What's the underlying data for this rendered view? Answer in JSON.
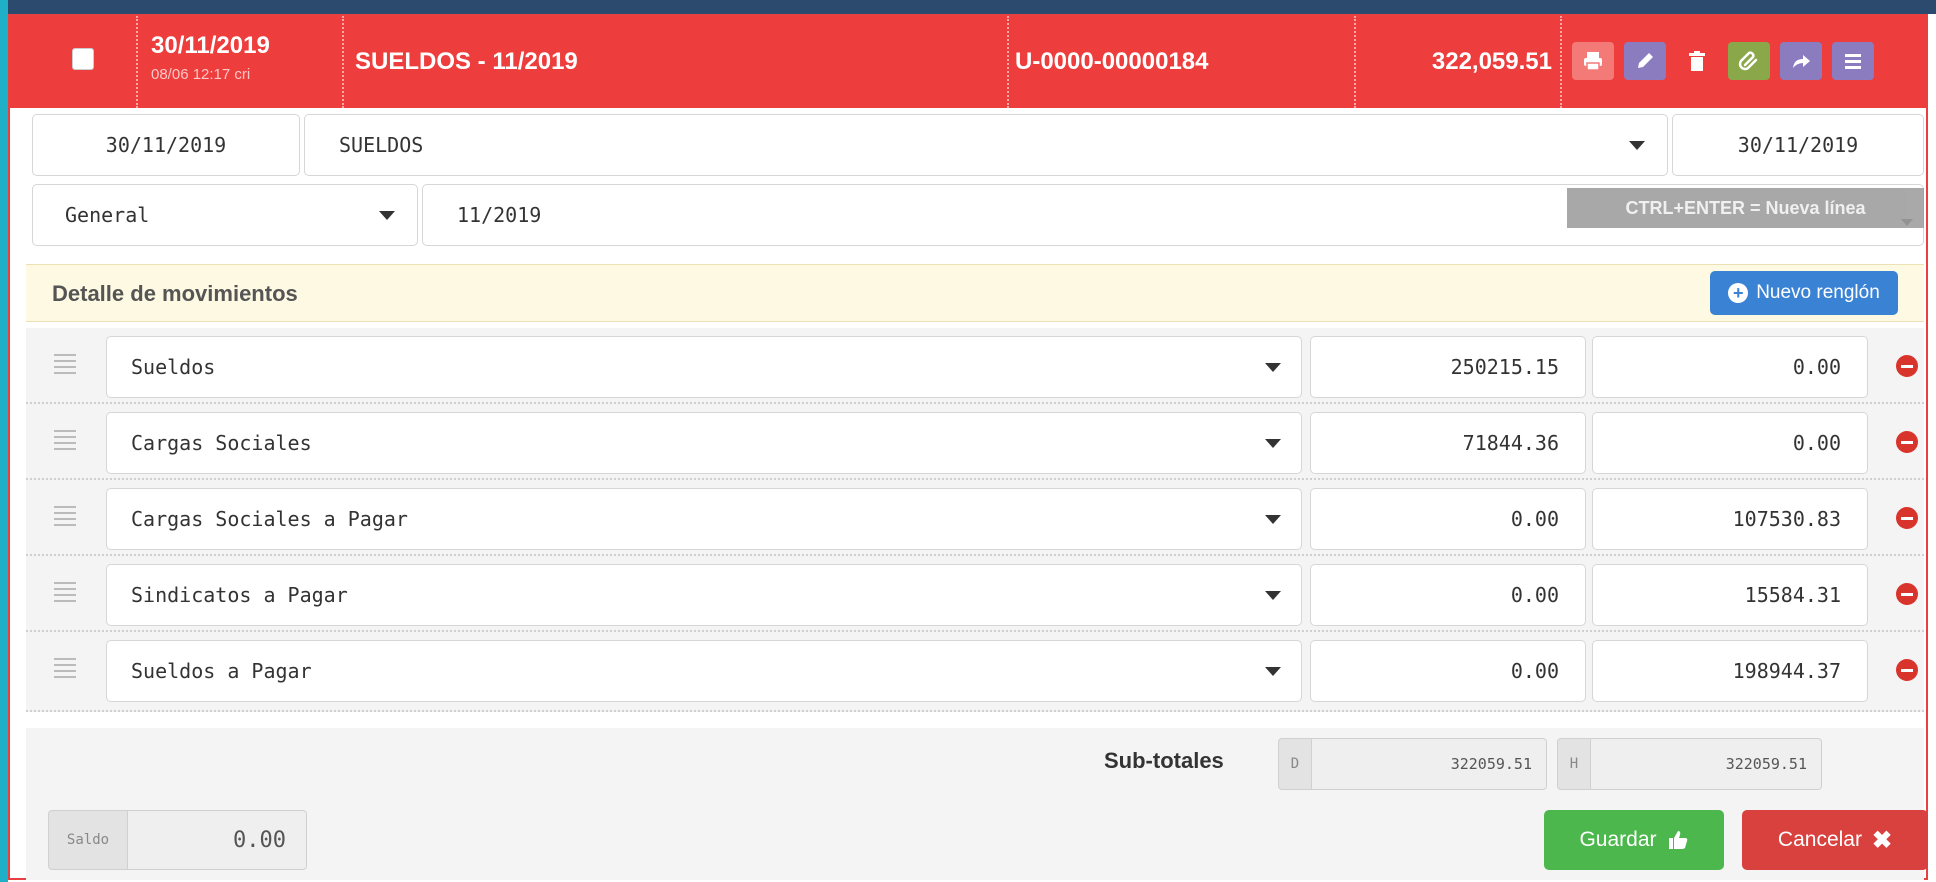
{
  "colors": {
    "header": "#ee3d3d",
    "success": "#4cb74c",
    "danger": "#d9413e",
    "primary": "#3a82d4"
  },
  "header": {
    "date": "30/11/2019",
    "sub": "08/06 12:17 cri",
    "title": "SUELDOS - 11/2019",
    "number": "U-0000-00000184",
    "amount": "322,059.51",
    "icons": [
      "print-icon",
      "pencil-icon",
      "trash-icon",
      "paperclip-icon",
      "share-icon",
      "menu-icon"
    ]
  },
  "form": {
    "date": "30/11/2019",
    "concept": "SUELDOS",
    "date2": "30/11/2019",
    "category": "General",
    "period": "11/2019",
    "hint": "CTRL+ENTER = Nueva línea"
  },
  "detail": {
    "title": "Detalle de movimientos",
    "new_row": "Nuevo renglón",
    "rows": [
      {
        "account": "Sueldos",
        "debit": "250215.15",
        "credit": "0.00"
      },
      {
        "account": "Cargas Sociales",
        "debit": "71844.36",
        "credit": "0.00"
      },
      {
        "account": "Cargas Sociales a Pagar",
        "debit": "0.00",
        "credit": "107530.83"
      },
      {
        "account": "Sindicatos a Pagar",
        "debit": "0.00",
        "credit": "15584.31"
      },
      {
        "account": "Sueldos a Pagar",
        "debit": "0.00",
        "credit": "198944.37"
      }
    ]
  },
  "totals": {
    "label": "Sub-totales",
    "d_label": "D",
    "d_value": "322059.51",
    "h_label": "H",
    "h_value": "322059.51"
  },
  "footer": {
    "saldo_label": "Saldo",
    "saldo_value": "0.00",
    "save": "Guardar",
    "cancel": "Cancelar"
  }
}
